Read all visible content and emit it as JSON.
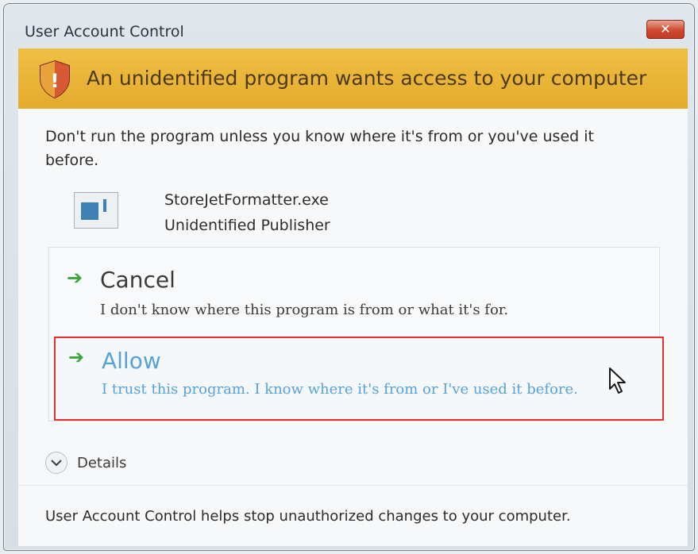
{
  "window": {
    "title": "User Account Control",
    "close_symbol": "✕"
  },
  "banner": {
    "icon": "shield-icon",
    "text": "An unidentified program wants access to your computer",
    "color": "#e8b336"
  },
  "warning": {
    "text": "Don't run the program unless you know where it's from or you've used it before."
  },
  "program": {
    "icon": "program-icon",
    "name": "StoreJetFormatter.exe",
    "publisher": "Unidentified Publisher"
  },
  "options": [
    {
      "icon": "arrow-right-icon",
      "title": "Cancel",
      "description": "I don't know where this program is from or what it's for."
    },
    {
      "icon": "arrow-right-icon",
      "title": "Allow",
      "description": "I trust this program. I know where it's from or I've used it before.",
      "highlight_color": "#e5322d",
      "text_color": "#57a2d8"
    }
  ],
  "details": {
    "icon": "chevron-down-icon",
    "label": "Details"
  },
  "footer": {
    "text": "User Account Control helps stop unauthorized changes to your computer."
  },
  "cursor": {
    "icon": "mouse-pointer-icon"
  }
}
